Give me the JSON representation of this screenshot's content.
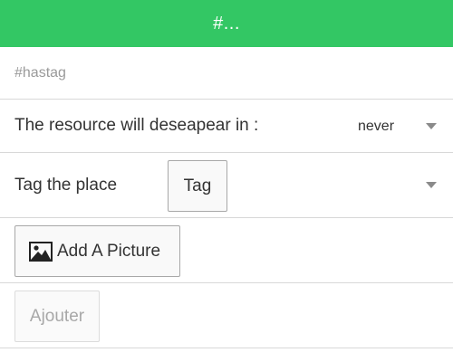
{
  "header": {
    "title": "#..."
  },
  "hashtag": {
    "placeholder": "#hastag",
    "value": ""
  },
  "expire": {
    "label": "The resource will deseapear in :",
    "selected": "never"
  },
  "tag_place": {
    "label": "Tag the place",
    "button_label": "Tag",
    "selected": ""
  },
  "picture": {
    "button_label": "Add A Picture",
    "icon": "image-icon"
  },
  "submit": {
    "button_label": "Ajouter",
    "disabled": true
  },
  "colors": {
    "header_bg": "#33c764",
    "header_text": "#ffffff",
    "divider": "#d8d8d8",
    "disabled_text": "#a8a8a8"
  }
}
